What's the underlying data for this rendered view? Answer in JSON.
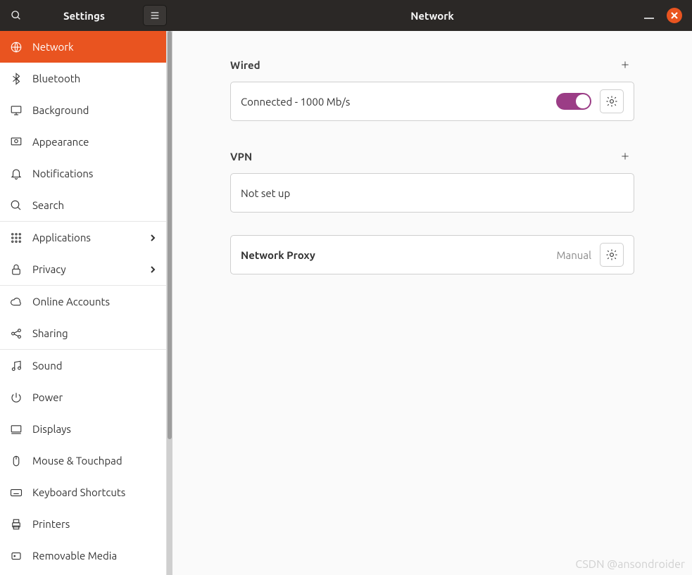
{
  "header": {
    "app_title": "Settings",
    "panel_title": "Network"
  },
  "sidebar": {
    "items": [
      {
        "id": "network",
        "label": "Network",
        "icon": "globe-icon",
        "active": true
      },
      {
        "id": "bluetooth",
        "label": "Bluetooth",
        "icon": "bluetooth-icon"
      },
      {
        "id": "background",
        "label": "Background",
        "icon": "desktop-icon"
      },
      {
        "id": "appearance",
        "label": "Appearance",
        "icon": "display-icon"
      },
      {
        "id": "notifications",
        "label": "Notifications",
        "icon": "bell-icon"
      },
      {
        "id": "search",
        "label": "Search",
        "icon": "search-icon"
      },
      {
        "id": "applications",
        "label": "Applications",
        "icon": "apps-icon",
        "chevron": true,
        "sep_before": true
      },
      {
        "id": "privacy",
        "label": "Privacy",
        "icon": "lock-icon",
        "chevron": true
      },
      {
        "id": "online-accounts",
        "label": "Online Accounts",
        "icon": "cloud-icon",
        "sep_before": true
      },
      {
        "id": "sharing",
        "label": "Sharing",
        "icon": "share-icon"
      },
      {
        "id": "sound",
        "label": "Sound",
        "icon": "music-icon",
        "sep_before": true
      },
      {
        "id": "power",
        "label": "Power",
        "icon": "power-icon"
      },
      {
        "id": "displays",
        "label": "Displays",
        "icon": "screen-icon"
      },
      {
        "id": "mouse",
        "label": "Mouse & Touchpad",
        "icon": "mouse-icon"
      },
      {
        "id": "keyboard",
        "label": "Keyboard Shortcuts",
        "icon": "keyboard-icon"
      },
      {
        "id": "printers",
        "label": "Printers",
        "icon": "printer-icon"
      },
      {
        "id": "removable",
        "label": "Removable Media",
        "icon": "disk-icon"
      }
    ]
  },
  "main": {
    "wired": {
      "title": "Wired",
      "status": "Connected - 1000 Mb/s",
      "enabled": true
    },
    "vpn": {
      "title": "VPN",
      "status": "Not set up"
    },
    "proxy": {
      "title": "Network Proxy",
      "mode": "Manual"
    }
  },
  "watermark": "CSDN @ansondroider"
}
